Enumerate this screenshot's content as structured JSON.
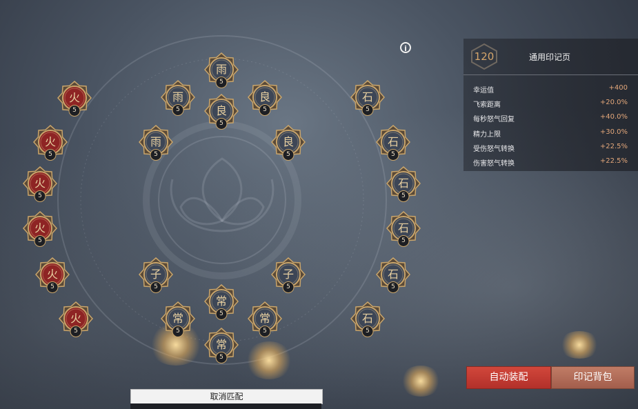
{
  "panel": {
    "points": "120",
    "title": "通用印记页",
    "stats": [
      {
        "name": "幸运值",
        "value": "+400"
      },
      {
        "name": "飞索距离",
        "value": "+20.0%"
      },
      {
        "name": "每秒怒气回复",
        "value": "+40.0%"
      },
      {
        "name": "精力上限",
        "value": "+30.0%"
      },
      {
        "name": "受伤怒气转换",
        "value": "+22.5%"
      },
      {
        "name": "伤害怒气转换",
        "value": "+22.5%"
      }
    ]
  },
  "buttons": {
    "auto_equip": "自动装配",
    "seal_bag": "印记背包",
    "cancel_match": "取消匹配"
  },
  "info_icon": "i",
  "colors": {
    "red_seal": "#8e2424",
    "blue_seal": "#3d4656",
    "gold_frame": "#c9a56b",
    "accent_red": "#c23a30"
  },
  "nodes": [
    {
      "glyph": "火",
      "level": "5",
      "kind": "red"
    },
    {
      "glyph": "火",
      "level": "5",
      "kind": "red"
    },
    {
      "glyph": "火",
      "level": "5",
      "kind": "red"
    },
    {
      "glyph": "火",
      "level": "5",
      "kind": "red"
    },
    {
      "glyph": "火",
      "level": "5",
      "kind": "red"
    },
    {
      "glyph": "火",
      "level": "5",
      "kind": "red"
    },
    {
      "glyph": "雨",
      "level": "5",
      "kind": "blue"
    },
    {
      "glyph": "雨",
      "level": "5",
      "kind": "blue"
    },
    {
      "glyph": "雨",
      "level": "5",
      "kind": "blue"
    },
    {
      "glyph": "良",
      "level": "5",
      "kind": "blue"
    },
    {
      "glyph": "良",
      "level": "5",
      "kind": "blue"
    },
    {
      "glyph": "良",
      "level": "5",
      "kind": "blue"
    },
    {
      "glyph": "子",
      "level": "5",
      "kind": "blue"
    },
    {
      "glyph": "子",
      "level": "5",
      "kind": "blue"
    },
    {
      "glyph": "常",
      "level": "5",
      "kind": "blue"
    },
    {
      "glyph": "常",
      "level": "5",
      "kind": "blue"
    },
    {
      "glyph": "常",
      "level": "5",
      "kind": "blue"
    },
    {
      "glyph": "常",
      "level": "5",
      "kind": "blue"
    },
    {
      "glyph": "石",
      "level": "5",
      "kind": "blue"
    },
    {
      "glyph": "石",
      "level": "5",
      "kind": "blue"
    },
    {
      "glyph": "石",
      "level": "5",
      "kind": "blue"
    },
    {
      "glyph": "石",
      "level": "5",
      "kind": "blue"
    },
    {
      "glyph": "石",
      "level": "5",
      "kind": "blue"
    },
    {
      "glyph": "石",
      "level": "5",
      "kind": "blue"
    }
  ]
}
